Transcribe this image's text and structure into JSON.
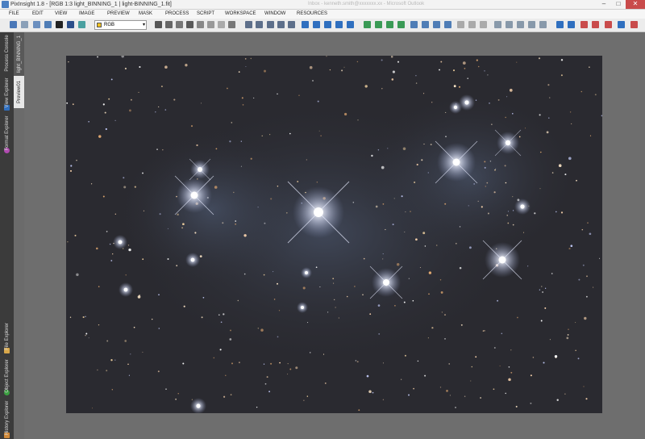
{
  "window": {
    "title": "PixInsight 1.8 - [RGB 1:3 light_BINNING_1 | light-BINNING_1.fit]",
    "ghost_title": "Inbox - kenneth.smith@xxxxxxx.xx - Microsoft Outlook"
  },
  "menu": [
    "FILE",
    "EDIT",
    "VIEW",
    "IMAGE",
    "PREVIEW",
    "MASK",
    "PROCESS",
    "SCRIPT",
    "WORKSPACE",
    "WINDOW",
    "RESOURCES"
  ],
  "toolbar": {
    "colorspace_value": "RGB"
  },
  "sidebar": {
    "process_console": "Process Console",
    "view_explorer": "View Explorer",
    "format_explorer": "Format Explorer",
    "file_explorer": "File Explorer",
    "object_explorer": "Object Explorer",
    "history_explorer": "History Explorer"
  },
  "view_tabs": {
    "view_id": "light_BINNING_1",
    "preview": "Preview01"
  },
  "colors": {
    "accent_blue": "#2f6fbf",
    "sky_background": "#2a2a30"
  }
}
